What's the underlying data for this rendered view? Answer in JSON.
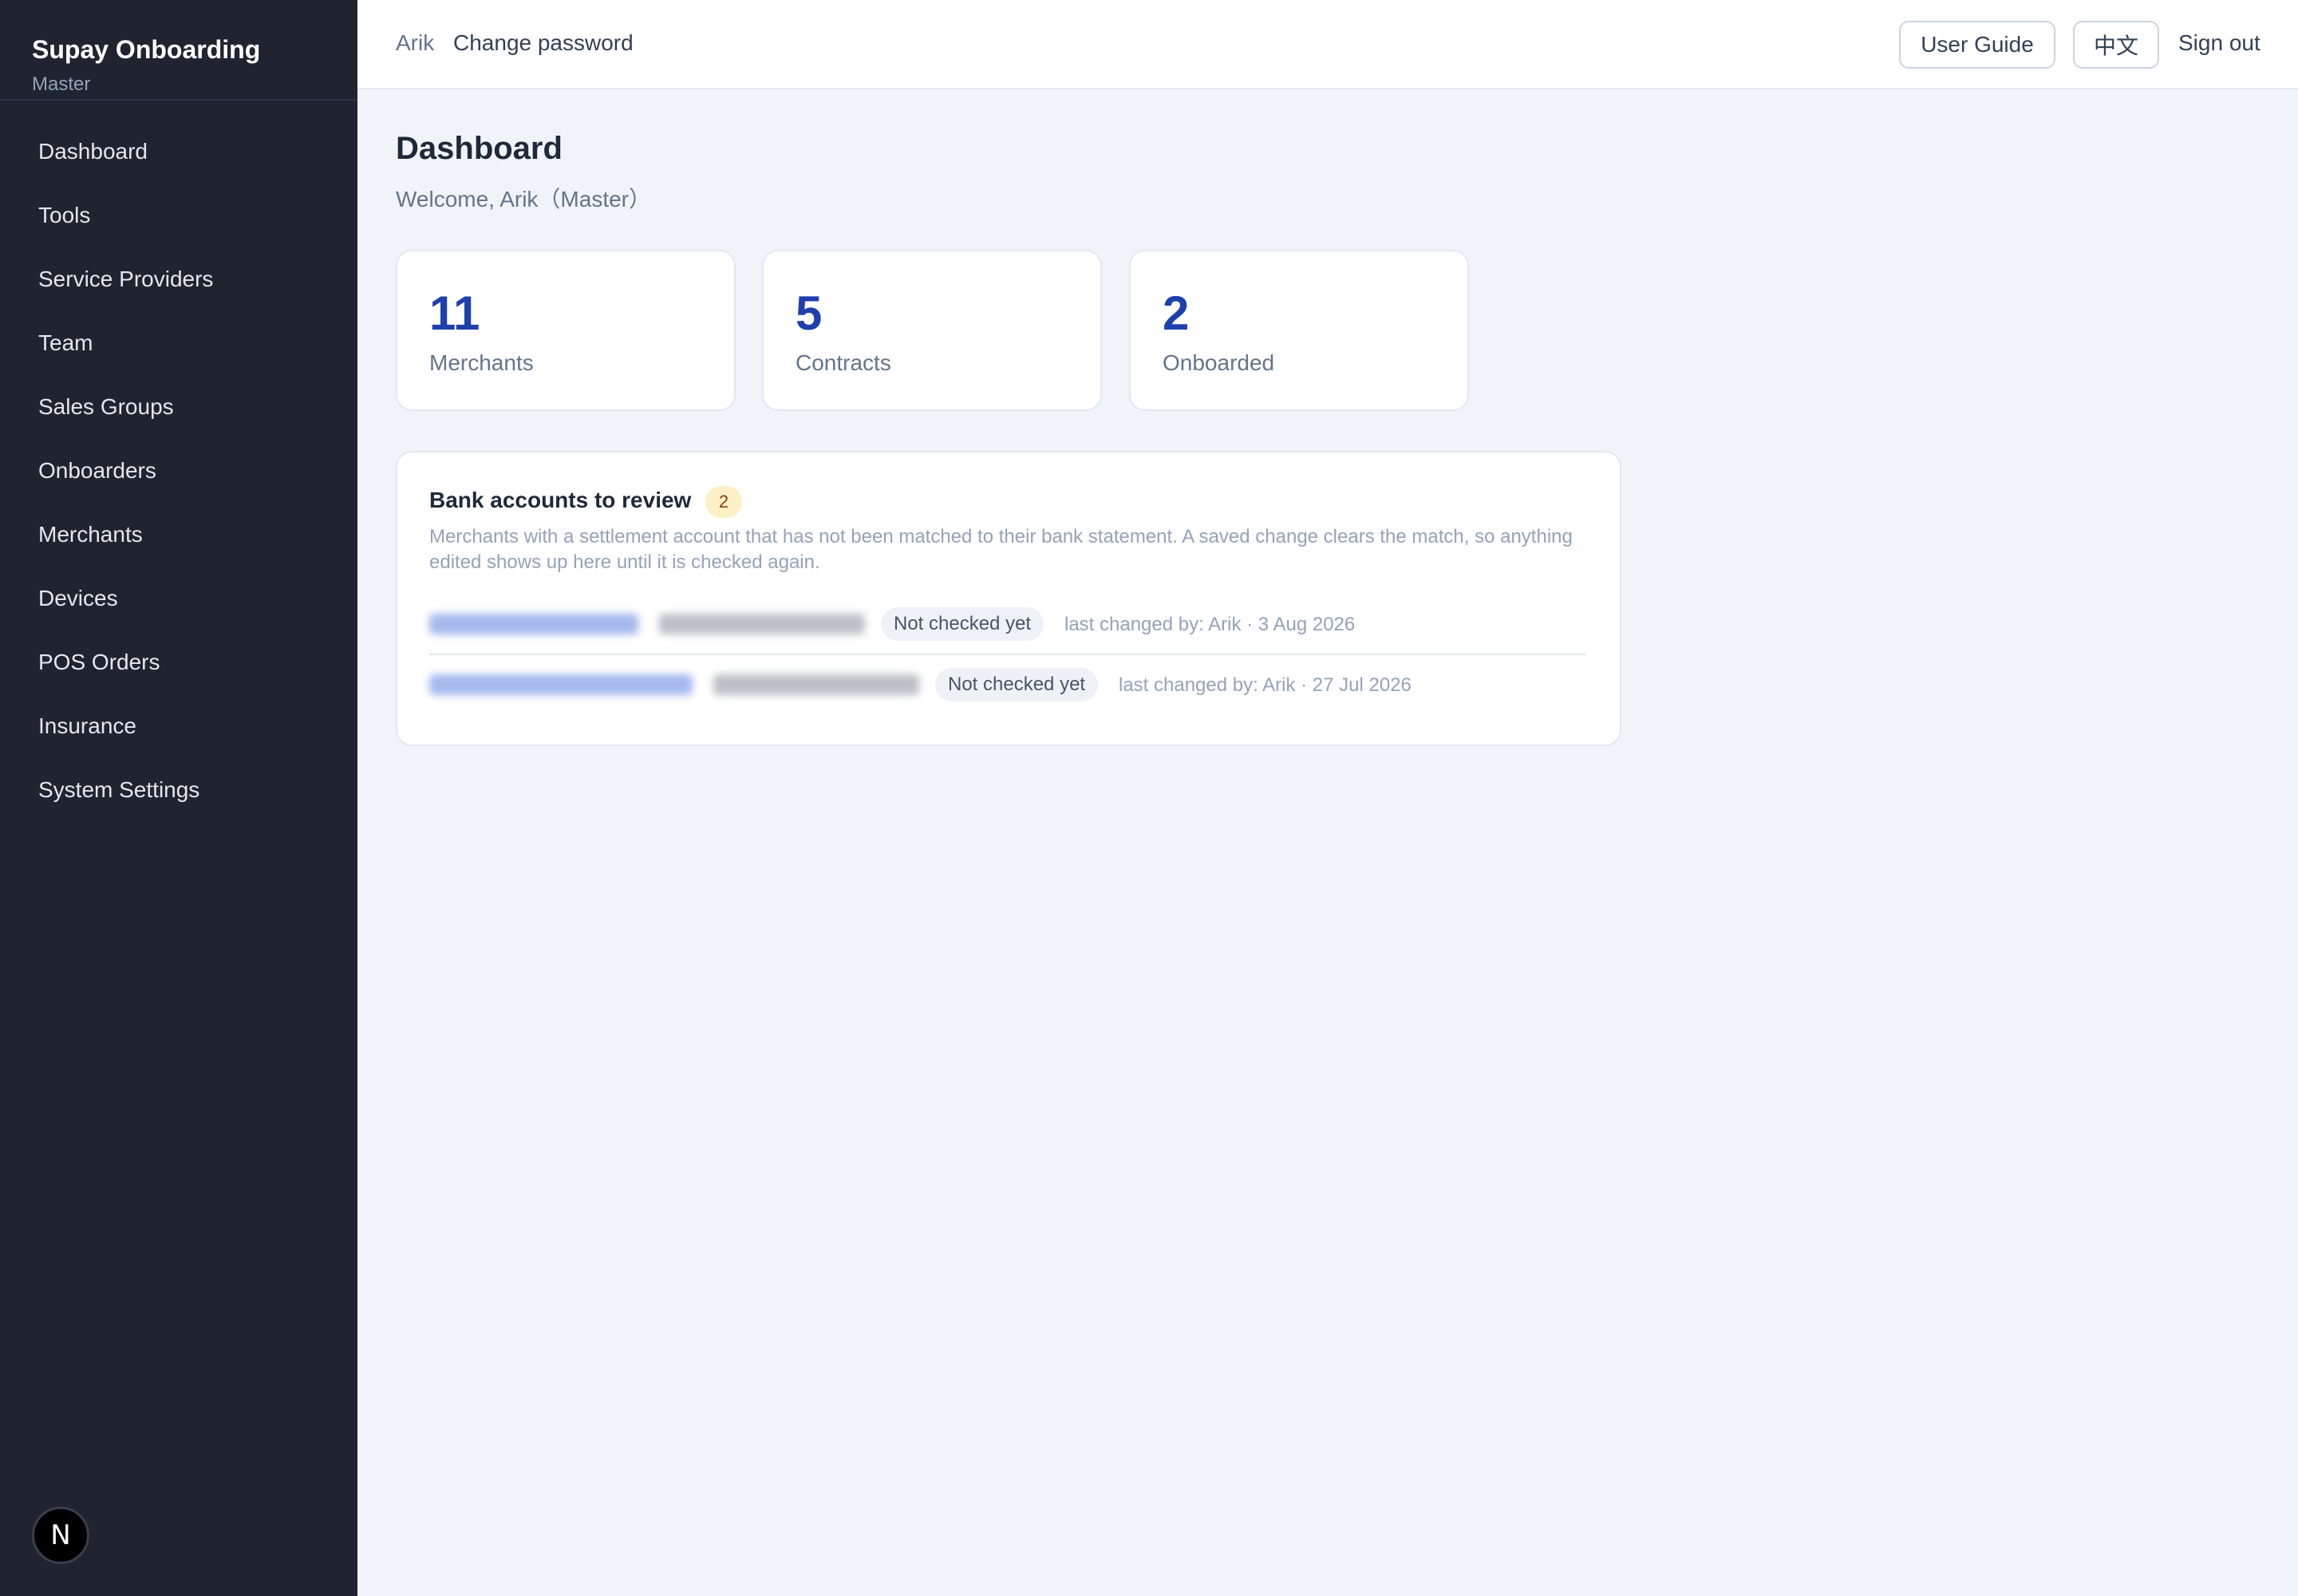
{
  "sidebar": {
    "title": "Supay Onboarding",
    "role": "Master",
    "items": [
      {
        "label": "Dashboard"
      },
      {
        "label": "Tools"
      },
      {
        "label": "Service Providers"
      },
      {
        "label": "Team"
      },
      {
        "label": "Sales Groups"
      },
      {
        "label": "Onboarders"
      },
      {
        "label": "Merchants"
      },
      {
        "label": "Devices"
      },
      {
        "label": "POS Orders"
      },
      {
        "label": "Insurance"
      },
      {
        "label": "System Settings"
      }
    ],
    "badge_letter": "N"
  },
  "header": {
    "user": "Arik",
    "change_password": "Change password",
    "user_guide": "User Guide",
    "language": "中文",
    "sign_out": "Sign out"
  },
  "main": {
    "title": "Dashboard",
    "welcome": "Welcome, Arik（Master）",
    "stats": [
      {
        "value": "11",
        "label": "Merchants"
      },
      {
        "value": "5",
        "label": "Contracts"
      },
      {
        "value": "2",
        "label": "Onboarded"
      }
    ],
    "review": {
      "title": "Bank accounts to review",
      "count": "2",
      "description": "Merchants with a settlement account that has not been matched to their bank statement. A saved change clears the match, so anything edited shows up here until it is checked again.",
      "rows": [
        {
          "status": "Not checked yet",
          "meta": "last changed by: Arik · 3 Aug 2026"
        },
        {
          "status": "Not checked yet",
          "meta": "last changed by: Arik · 27 Jul 2026"
        }
      ]
    }
  },
  "colors": {
    "sidebar_bg": "#1f2430",
    "accent_number": "#1e3fae",
    "page_bg": "#f0f4f8"
  }
}
